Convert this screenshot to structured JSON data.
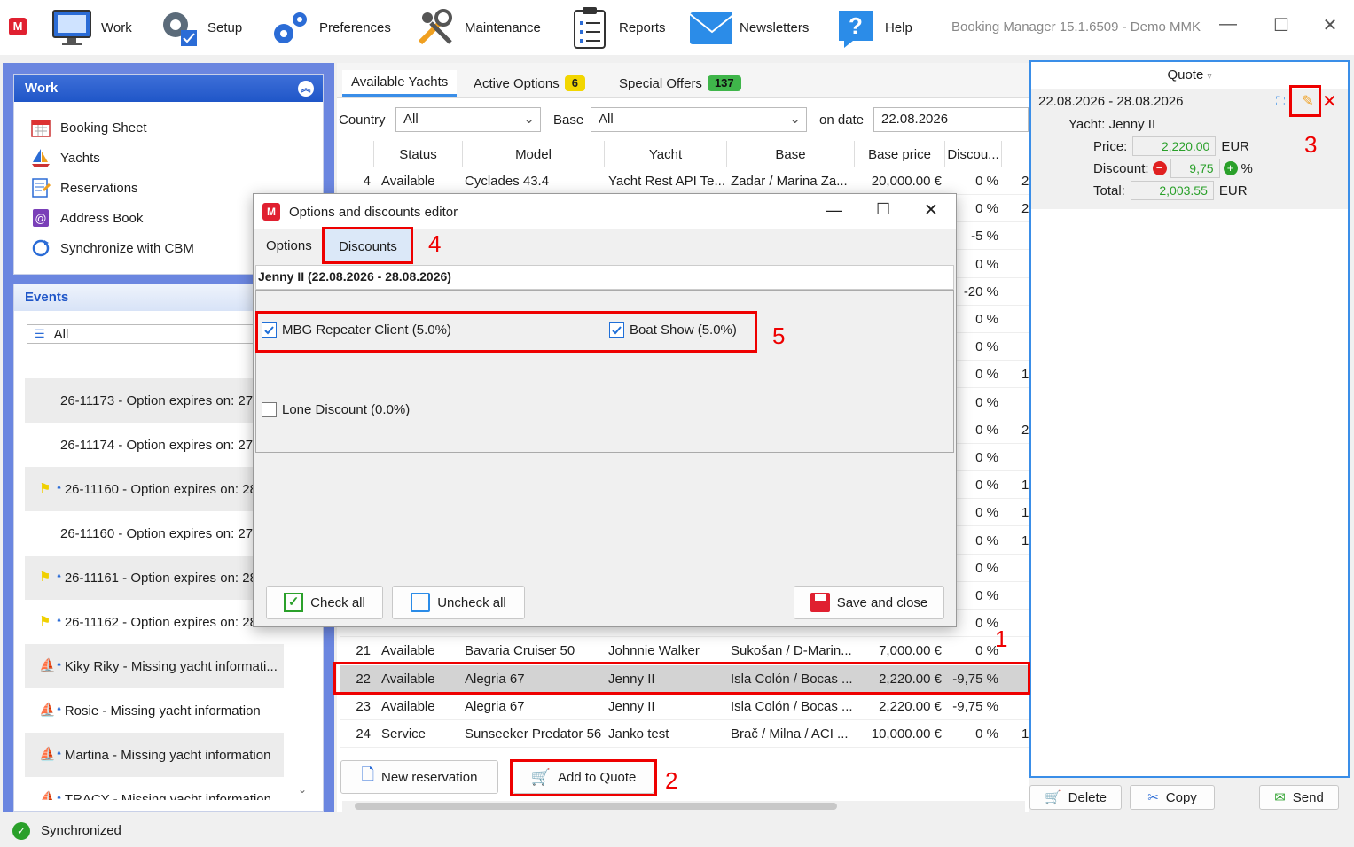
{
  "toolbar": {
    "items": [
      {
        "label": "Work",
        "icon": "monitor-icon"
      },
      {
        "label": "Setup",
        "icon": "gears-icon"
      },
      {
        "label": "Preferences",
        "icon": "gears-icon"
      },
      {
        "label": "Maintenance",
        "icon": "tools-icon"
      },
      {
        "label": "Reports",
        "icon": "clipboard-icon"
      },
      {
        "label": "Newsletters",
        "icon": "envelope-icon"
      },
      {
        "label": "Help",
        "icon": "help-icon"
      }
    ],
    "window_title": "Booking Manager 15.1.6509 - Demo MMK",
    "minimize": "—",
    "maximize": "☐",
    "close": "✕"
  },
  "work_panel": {
    "title": "Work",
    "items": [
      {
        "label": "Booking Sheet"
      },
      {
        "label": "Yachts"
      },
      {
        "label": "Reservations"
      },
      {
        "label": "Address Book"
      },
      {
        "label": "Synchronize with CBM"
      }
    ]
  },
  "events_panel": {
    "title": "Events",
    "filter": "All",
    "rows": [
      {
        "text": "26-11173 - Option expires on: 27",
        "flag": false
      },
      {
        "text": "26-11174 - Option expires on: 27",
        "flag": false
      },
      {
        "text": "26-11160 - Option expires on: 28",
        "flag": true
      },
      {
        "text": "26-11160 - Option expires on: 27",
        "flag": false
      },
      {
        "text": "26-11161 - Option expires on: 28",
        "flag": true
      },
      {
        "text": "26-11162 - Option expires on: 28",
        "flag": true
      },
      {
        "text": "Kiky Riky - Missing yacht informati...",
        "flag": false
      },
      {
        "text": "Rosie - Missing yacht information",
        "flag": false
      },
      {
        "text": "Martina - Missing yacht information",
        "flag": false
      },
      {
        "text": "TRACY - Missing yacht information",
        "flag": false
      }
    ]
  },
  "center": {
    "tabs": [
      {
        "label": "Available Yachts"
      },
      {
        "label": "Active Options",
        "badge": "6",
        "badge_color": "#f2d600"
      },
      {
        "label": "Special Offers",
        "badge": "137",
        "badge_color": "#3fb54a"
      }
    ],
    "filters": {
      "country_label": "Country",
      "country_value": "All",
      "base_label": "Base",
      "base_value": "All",
      "date_label": "on date",
      "date_value": "22.08.2026"
    },
    "columns": [
      "Status",
      "Model",
      "Yacht",
      "Base",
      "Base price",
      "Discou..."
    ],
    "rows": [
      {
        "num": "4",
        "status": "Available",
        "model": "Cyclades 43.4",
        "yacht": "Yacht Rest API Te...",
        "base": "Zadar / Marina Za...",
        "price": "20,000.00 €",
        "discount": "0 %",
        "extra": "2"
      },
      {
        "discount": "0 %",
        "extra": "2"
      },
      {
        "discount": "-5 %",
        "extra": ""
      },
      {
        "discount": "0 %",
        "extra": ""
      },
      {
        "discount": "-20 %",
        "extra": ""
      },
      {
        "discount": "0 %",
        "extra": ""
      },
      {
        "discount": "0 %",
        "extra": ""
      },
      {
        "discount": "0 %",
        "extra": "1"
      },
      {
        "discount": "0 %",
        "extra": ""
      },
      {
        "discount": "0 %",
        "extra": "2"
      },
      {
        "discount": "0 %",
        "extra": ""
      },
      {
        "discount": "0 %",
        "extra": "1"
      },
      {
        "discount": "0 %",
        "extra": "1"
      },
      {
        "discount": "0 %",
        "extra": "1"
      },
      {
        "discount": "0 %",
        "extra": ""
      },
      {
        "discount": "0 %",
        "extra": ""
      },
      {
        "discount": "0 %",
        "extra": ""
      },
      {
        "num": "21",
        "status": "Available",
        "model": "Bavaria Cruiser 50",
        "yacht": "Johnnie Walker",
        "base": "Sukošan / D-Marin...",
        "price": "7,000.00 €",
        "discount": "0 %",
        "extra": ""
      },
      {
        "num": "22",
        "status": "Available",
        "model": "Alegria 67",
        "yacht": "Jenny II",
        "base": "Isla Colón / Bocas ...",
        "price": "2,220.00 €",
        "discount": "-9,75 %",
        "extra": ""
      },
      {
        "num": "23",
        "status": "Available",
        "model": "Alegria 67",
        "yacht": "Jenny II",
        "base": "Isla Colón / Bocas ...",
        "price": "2,220.00 €",
        "discount": "-9,75 %",
        "extra": ""
      },
      {
        "num": "24",
        "status": "Service",
        "model": "Sunseeker Predator 56",
        "yacht": "Janko test",
        "base": "Brač / Milna / ACI ...",
        "price": "10,000.00 €",
        "discount": "0 %",
        "extra": "1"
      }
    ],
    "new_reservation": "New reservation",
    "add_to_quote": "Add to Quote"
  },
  "quote": {
    "title": "Quote",
    "dates": "22.08.2026 - 28.08.2026",
    "yacht": "Yacht: Jenny II",
    "price_label": "Price:",
    "price_value": "2,220.00",
    "price_currency": "EUR",
    "discount_label": "Discount:",
    "discount_value": "9,75",
    "discount_unit": "%",
    "total_label": "Total:",
    "total_value": "2,003.55",
    "total_currency": "EUR",
    "delete": "Delete",
    "copy": "Copy",
    "send": "Send"
  },
  "dialog": {
    "title": "Options and discounts editor",
    "tab_options": "Options",
    "tab_discounts": "Discounts",
    "header": "Jenny II (22.08.2026 - 28.08.2026)",
    "discounts": [
      {
        "label": "MBG Repeater Client (5.0%)",
        "checked": true
      },
      {
        "label": "Boat Show (5.0%)",
        "checked": true
      },
      {
        "label": "Lone Discount (0.0%)",
        "checked": false
      }
    ],
    "check_all": "Check all",
    "uncheck_all": "Uncheck all",
    "save_close": "Save and close"
  },
  "annotations": [
    "1",
    "2",
    "3",
    "4",
    "5"
  ],
  "status": {
    "text": "Synchronized"
  }
}
